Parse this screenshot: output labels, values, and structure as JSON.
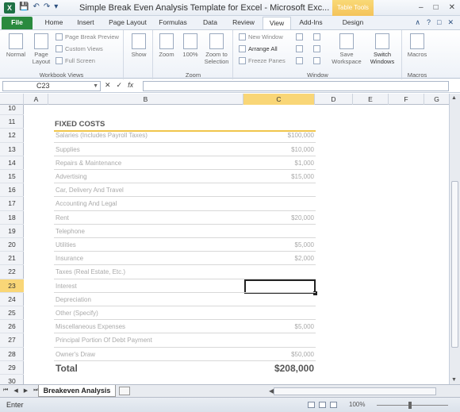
{
  "window": {
    "title": "Simple Break Even Analysis Template for Excel - Microsoft Exc...",
    "context_tab": "Table Tools",
    "app_icon": "X"
  },
  "ribbon_tabs": [
    "File",
    "Home",
    "Insert",
    "Page Layout",
    "Formulas",
    "Data",
    "Review",
    "View",
    "Add-Ins",
    "Design"
  ],
  "active_tab": "View",
  "ribbon": {
    "workbook_views": {
      "label": "Workbook Views",
      "normal": "Normal",
      "page_layout": "Page Layout",
      "page_break_preview": "Page Break Preview",
      "custom_views": "Custom Views",
      "full_screen": "Full Screen"
    },
    "show": {
      "label": "Show"
    },
    "zoom": {
      "label": "Zoom",
      "zoom": "Zoom",
      "hundred": "100%",
      "zoom_to_selection": "Zoom to Selection"
    },
    "window": {
      "label": "Window",
      "new_window": "New Window",
      "arrange_all": "Arrange All",
      "freeze_panes": "Freeze Panes",
      "save_workspace": "Save Workspace",
      "switch_windows": "Switch Windows"
    },
    "macros": {
      "label": "Macros",
      "macros": "Macros"
    }
  },
  "formula_bar": {
    "name_box": "C23",
    "cancel": "✕",
    "enter": "✓",
    "fx": "fx",
    "content": ""
  },
  "columns": [
    "A",
    "B",
    "C",
    "D",
    "E",
    "F",
    "G"
  ],
  "selected_column": "C",
  "row_numbers": [
    "10",
    "11",
    "12",
    "13",
    "14",
    "15",
    "16",
    "17",
    "18",
    "19",
    "20",
    "21",
    "22",
    "23",
    "24",
    "25",
    "26",
    "27",
    "28",
    "29",
    "30"
  ],
  "selected_row": "23",
  "sheet": {
    "heading": "FIXED COSTS",
    "items": [
      {
        "label": "Salaries (Includes Payroll Taxes)",
        "value": "$100,000"
      },
      {
        "label": "Supplies",
        "value": "$10,000"
      },
      {
        "label": "Repairs & Maintenance",
        "value": "$1,000"
      },
      {
        "label": "Advertising",
        "value": "$15,000"
      },
      {
        "label": "Car, Delivery And Travel",
        "value": ""
      },
      {
        "label": "Accounting And Legal",
        "value": ""
      },
      {
        "label": "Rent",
        "value": "$20,000"
      },
      {
        "label": "Telephone",
        "value": ""
      },
      {
        "label": "Utilities",
        "value": "$5,000"
      },
      {
        "label": "Insurance",
        "value": "$2,000"
      },
      {
        "label": "Taxes (Real Estate, Etc.)",
        "value": ""
      },
      {
        "label": "Interest",
        "value": ""
      },
      {
        "label": "Depreciation",
        "value": ""
      },
      {
        "label": "Other (Specify)",
        "value": ""
      },
      {
        "label": "Miscellaneous Expenses",
        "value": "$5,000"
      },
      {
        "label": "Principal Portion Of Debt Payment",
        "value": ""
      },
      {
        "label": "Owner's Draw",
        "value": "$50,000"
      }
    ],
    "total_label": "Total",
    "total_value": "$208,000"
  },
  "sheet_tabs": {
    "active": "Breakeven Analysis"
  },
  "status_bar": {
    "mode": "Enter",
    "zoom": "100%"
  }
}
